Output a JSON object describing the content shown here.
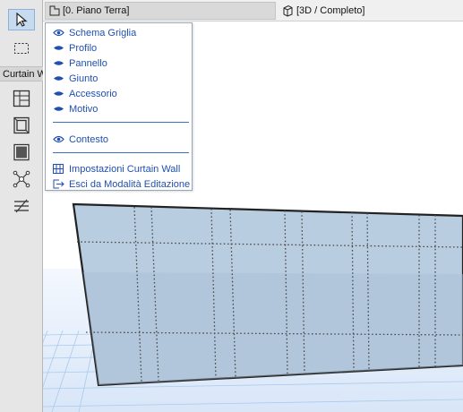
{
  "toolbox": {
    "mode_label": "Curtain Wall",
    "tools": [
      {
        "icon": "arrow-pointer-icon",
        "active": true
      },
      {
        "icon": "marquee-select-icon",
        "active": false
      },
      {
        "icon": "grid-scheme-icon",
        "active": false
      },
      {
        "icon": "frame-icon",
        "active": false
      },
      {
        "icon": "panel-icon",
        "active": false
      },
      {
        "icon": "junction-icon",
        "active": false
      },
      {
        "icon": "accessory-icon",
        "active": false
      }
    ]
  },
  "tabs": {
    "plan_label": "[0. Piano Terra]",
    "view3d_label": "[3D / Completo]"
  },
  "menu": {
    "items": [
      {
        "label": "Schema Griglia",
        "icon": "eye-open-icon"
      },
      {
        "label": "Profilo",
        "icon": "eye-closed-icon"
      },
      {
        "label": "Pannello",
        "icon": "eye-closed-icon"
      },
      {
        "label": "Giunto",
        "icon": "eye-closed-icon"
      },
      {
        "label": "Accessorio",
        "icon": "eye-closed-icon"
      },
      {
        "label": "Motivo",
        "icon": "eye-closed-icon"
      }
    ],
    "context_item": {
      "label": "Contesto",
      "icon": "eye-open-icon"
    },
    "action_items": [
      {
        "label": "Impostazioni Curtain Wall",
        "icon": "curtain-wall-settings-icon"
      },
      {
        "label": "Esci da Modalità Editazione",
        "icon": "exit-edit-mode-icon"
      }
    ]
  },
  "colors": {
    "menu_text": "#1f4fb0",
    "active_tool_bg": "#c6daf0",
    "panel_fill": "#b9cde0",
    "ground_grid": "#a9c9ef"
  }
}
